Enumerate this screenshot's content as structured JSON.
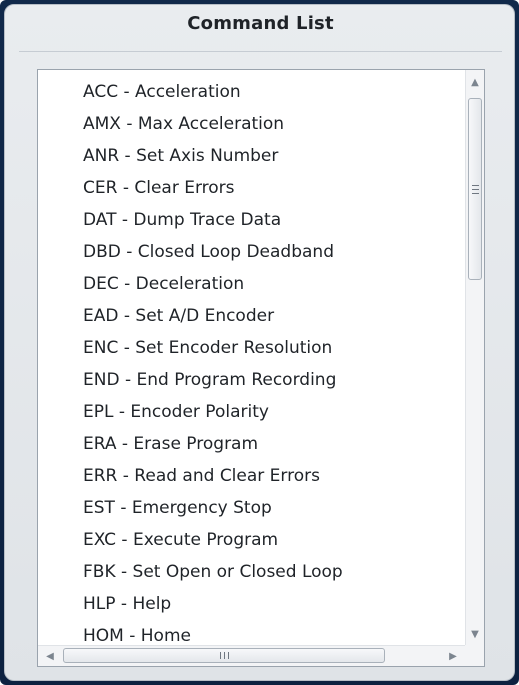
{
  "panel": {
    "title": "Command List"
  },
  "commands": [
    "ACC - Acceleration",
    "AMX - Max Acceleration",
    "ANR - Set Axis Number",
    "CER - Clear Errors",
    "DAT - Dump Trace Data",
    "DBD - Closed Loop Deadband",
    "DEC - Deceleration",
    "EAD - Set A/D Encoder",
    "ENC - Set Encoder Resolution",
    "END - End Program Recording",
    "EPL - Encoder Polarity",
    "ERA - Erase Program",
    "ERR - Read and Clear Errors",
    "EST - Emergency Stop",
    "EXC - Execute Program",
    "FBK - Set Open or Closed Loop",
    "HLP - Help",
    "HOM - Home"
  ],
  "scrollbars": {
    "up_icon": "triangle-up",
    "down_icon": "triangle-down",
    "left_icon": "triangle-left",
    "right_icon": "triangle-right",
    "vertical_position": 0.0,
    "horizontal_position": 0.0
  }
}
